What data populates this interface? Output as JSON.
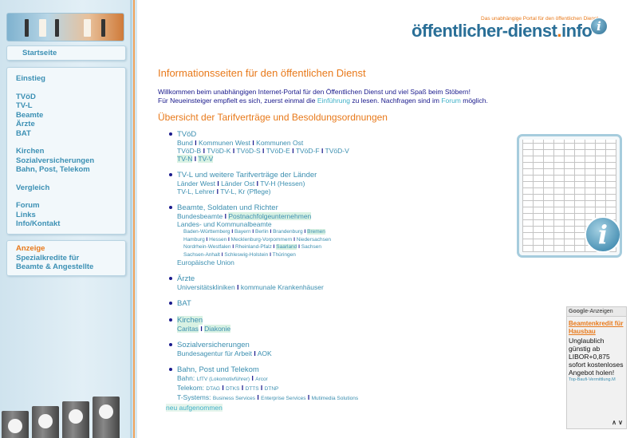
{
  "header": {
    "tagline": "Das unabhängige Portal für den öffentlichen Dienst",
    "brand_main": "öffentlicher-dienst",
    "brand_dot": ".",
    "brand_tld": "info",
    "info_icon": "i"
  },
  "sidebar": {
    "home": "Startseite",
    "group1": [
      "Einstieg"
    ],
    "group2": [
      "TVöD",
      "TV-L",
      "Beamte",
      "Ärzte",
      "BAT"
    ],
    "group3": [
      "Kirchen",
      "Sozialversicherungen",
      "Bahn, Post, Telekom"
    ],
    "group4": [
      "Vergleich"
    ],
    "group5": [
      "Forum",
      "Links",
      "Info/Kontakt"
    ],
    "ad_label": "Anzeige",
    "ad_text_1": "Spezialkredite für",
    "ad_text_2": "Beamte & Angestellte"
  },
  "main": {
    "title": "Informationsseiten für den öffentlichen Dienst",
    "intro_1": "Willkommen beim unabhängigen Internet-Portal für den Öffentlichen Dienst und viel Spaß beim Stöbern!",
    "intro_2a": "Für Neueinsteiger empfielt es sich, zuerst einmal die ",
    "intro_2_link1": "Einführung",
    "intro_2b": " zu lesen. Nachfragen sind im ",
    "intro_2_link2": "Forum",
    "intro_2c": " möglich.",
    "section_title": "Übersicht der Tarifverträge und Besoldungsordnungen",
    "sep": "I",
    "tvoed": {
      "head": "TVöD",
      "r1": [
        "Bund",
        "Kommunen West",
        "Kommunen Ost"
      ],
      "r2": [
        "TVöD-B",
        "TVöD-K",
        "TVöD-S",
        "TVöD-E",
        "TVöD-F",
        "TVöD-V"
      ],
      "r3": [
        "TV-N",
        "TV-V"
      ]
    },
    "tvl": {
      "head": "TV-L und weitere Tarifverträge der Länder",
      "r1": [
        "Länder West",
        "Länder Ost",
        "TV-H (Hessen)"
      ],
      "r2": [
        "TV-L, Lehrer",
        "TV-L, Kr (Pflege)"
      ]
    },
    "beamte": {
      "head": "Beamte, Soldaten und Richter",
      "r1": [
        "Bundesbeamte",
        "Postnachfolgeunternehmen"
      ],
      "r2": "Landes- und Kommunalbeamte",
      "s1": [
        "Baden-Württemberg",
        "Bayern",
        "Berlin",
        "Brandenburg",
        "Bremen"
      ],
      "s2": [
        "Hamburg",
        "Hessen",
        "Mecklenburg-Vorpommern",
        "Niedersachsen"
      ],
      "s3": [
        "Nordrhein-Westfalen",
        "Rheinland-Pfalz",
        "Saarland",
        "Sachsen"
      ],
      "s4": [
        "Sachsen-Anhalt",
        "Schleswig-Holstein",
        "Thüringen"
      ],
      "r3": "Europäische Union"
    },
    "aerzte": {
      "head": "Ärzte",
      "r1": [
        "Universitätskliniken",
        "kommunale Krankenhäuser"
      ]
    },
    "bat": {
      "head": "BAT"
    },
    "kirchen": {
      "head": "Kirchen",
      "r1": [
        "Caritas",
        "Diakonie"
      ]
    },
    "sozial": {
      "head": "Sozialversicherungen",
      "r1": [
        "Bundesagentur für Arbeit",
        "AOK"
      ]
    },
    "bahn": {
      "head": "Bahn, Post und Telekom",
      "bahn_label": "Bahn:",
      "bahn_items": [
        "LfTV (Lokomotivführer)",
        "Arcor"
      ],
      "tel_label": "Telekom:",
      "tel_items": [
        "DTAG",
        "DTKS",
        "DTTS",
        "DTNP"
      ],
      "tsys_label": "T-Systems:",
      "tsys_items": [
        "Business Services",
        "Enterprise Services",
        "Mutimedia Solutions"
      ]
    },
    "new_label": "neu aufgenommen"
  },
  "ad": {
    "google": "Google",
    "header_suffix": "-Anzeigen",
    "title": "Beamtenkredit für Hausbau",
    "text": "Unglaublich günstig ab LIBOR+0,875 sofort kostenloses Angebot holen!",
    "url": "Top-Baufi-Vermittlung.M",
    "nav": "∧ ∨"
  },
  "colors": {
    "orange": "#e8791a",
    "link_blue": "#3c8fb0",
    "text_navy": "#1a1a8c",
    "highlight": "#d9f2e3"
  }
}
